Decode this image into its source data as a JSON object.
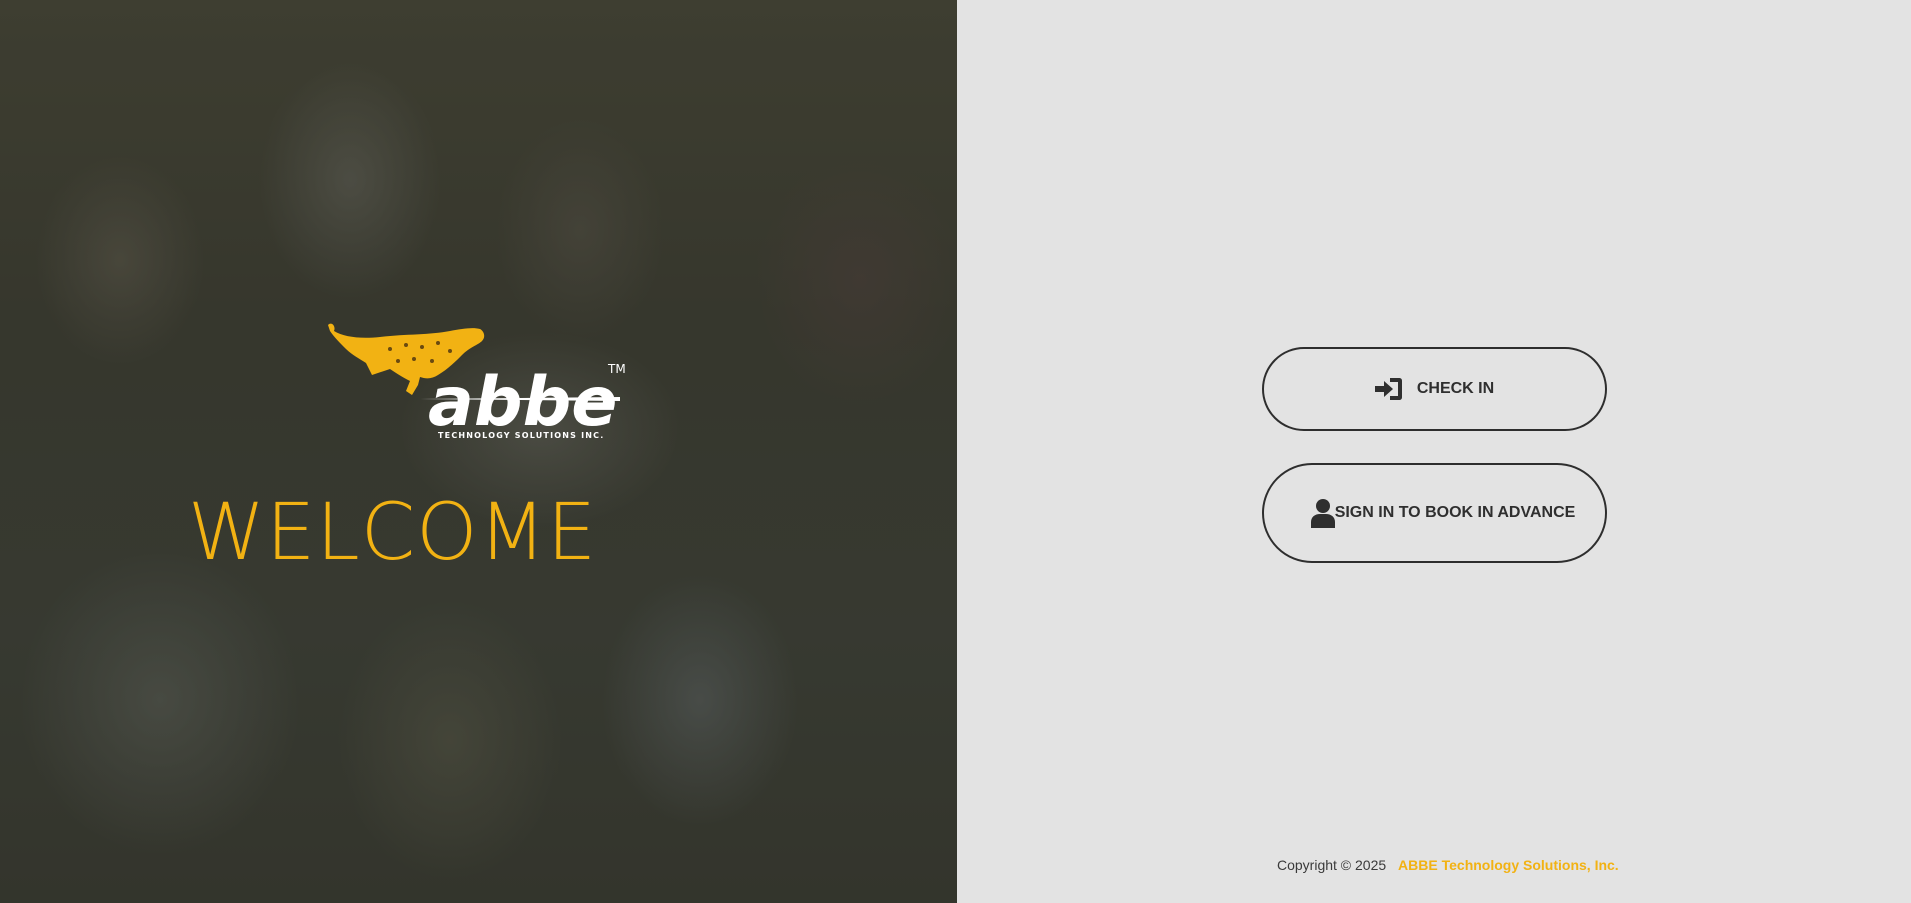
{
  "hero": {
    "logo_word": "abbe",
    "logo_tm": "TM",
    "logo_tagline": "TECHNOLOGY SOLUTIONS INC.",
    "welcome_text": "WELCOME"
  },
  "actions": {
    "check_in_label": "CHECK IN",
    "check_in_icon": "sign-in-icon",
    "sign_in_label": "SIGN IN TO BOOK IN ADVANCE",
    "sign_in_icon": "user-icon"
  },
  "footer": {
    "copyright": "Copyright © 2025",
    "company": "ABBE Technology Solutions, Inc."
  },
  "colors": {
    "accent": "#f2b213",
    "panel_background": "#e3e3e3",
    "button_border": "#2e2e2e",
    "text_dark": "#2f2f2f"
  }
}
